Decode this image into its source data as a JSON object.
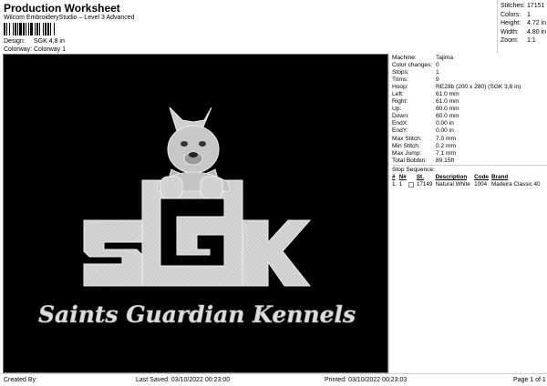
{
  "header": {
    "title": "Production Worksheet",
    "subtitle": "Wilcom EmbroideryStudio – Level 3 Advanced",
    "design_label": "Design:",
    "design_value": "SGK 4,8 in",
    "colorway_label": "Colorway:",
    "colorway_value": "Colorway 1"
  },
  "stats": [
    {
      "label": "Stitches:",
      "value": "17151"
    },
    {
      "label": "Colors:",
      "value": "1"
    },
    {
      "label": "Height:",
      "value": "4.72 in"
    },
    {
      "label": "Width:",
      "value": "4.80 in"
    },
    {
      "label": "Zoom:",
      "value": "1:1"
    }
  ],
  "machine_info": [
    {
      "label": "Machine:",
      "value": "Tajima"
    },
    {
      "label": "Color changes:",
      "value": "0"
    },
    {
      "label": "Stops:",
      "value": "1"
    },
    {
      "label": "Trims:",
      "value": "9"
    },
    {
      "label": "Hoop:",
      "value": "RE28b (200 x 280) (SGK 3,8 in)"
    },
    {
      "label": "Left:",
      "value": "61.0 mm"
    },
    {
      "label": "Right:",
      "value": "61.0 mm"
    },
    {
      "label": "Up:",
      "value": "60.0 mm"
    },
    {
      "label": "Down:",
      "value": "60.0 mm"
    },
    {
      "label": "EndX:",
      "value": "0.00 in"
    },
    {
      "label": "EndY:",
      "value": "0.00 in"
    },
    {
      "label": "Max Stitch:",
      "value": "7.0 mm"
    },
    {
      "label": "Min Stitch:",
      "value": "0.2 mm"
    },
    {
      "label": "Max Jump:",
      "value": "7.1 mm"
    },
    {
      "label": "Total Bobbin:",
      "value": "89.15ft"
    }
  ],
  "stop_sequence": {
    "title": "Stop Sequence:",
    "headers": [
      "#",
      "N#",
      "",
      "St.",
      "Description",
      "Code",
      "Brand"
    ],
    "rows": [
      {
        "num": "1.",
        "n": "1",
        "stitches": "17149",
        "description": "Natural White",
        "code": "1004",
        "brand": "Madeira Classic 40",
        "color": "#ffffff"
      }
    ]
  },
  "design": {
    "logo_text": "SGK",
    "tagline": "Saints Guardian Kennels",
    "thread_color": "#dcdcdc",
    "background_color": "#000000"
  },
  "footer": {
    "created_by": "Created By:",
    "last_saved": "Last Saved: 03/10/2022 00:23:00",
    "printed": "Printed: 03/10/2022 00:23:03",
    "page": "Page 1 of 1"
  }
}
